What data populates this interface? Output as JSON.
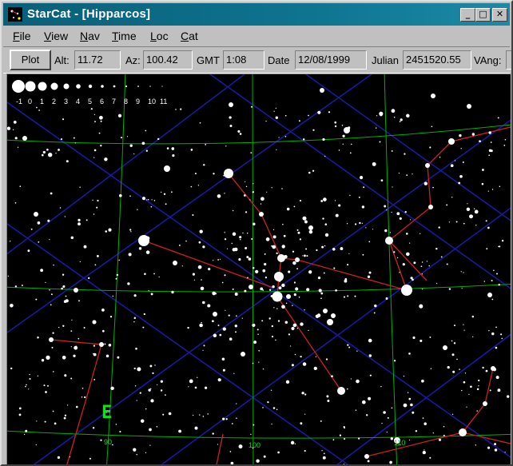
{
  "window": {
    "title": "StarCat - [Hipparcos]",
    "icon": "starcat-app-icon",
    "controls": {
      "minimize": "_",
      "maximize": "□",
      "close": "✕"
    }
  },
  "menu": [
    {
      "label": "File"
    },
    {
      "label": "View"
    },
    {
      "label": "Nav"
    },
    {
      "label": "Time"
    },
    {
      "label": "Loc"
    },
    {
      "label": "Cat"
    }
  ],
  "toolbar": {
    "plot_label": "Plot",
    "alt_label": "Alt:",
    "alt_value": "11.72",
    "az_label": "Az:",
    "az_value": "100.42",
    "gmt_label": "GMT",
    "gmt_value": "1:08",
    "date_label": "Date",
    "date_value": "12/08/1999",
    "julian_label": "Julian",
    "julian_value": "2451520.55",
    "vang_label": "VAng:"
  },
  "sky": {
    "magnitude_legend": [
      "-1",
      "0",
      "1",
      "2",
      "3",
      "4",
      "5",
      "6",
      "7",
      "8",
      "9",
      "10",
      "11"
    ],
    "horizon_marks": [
      "90",
      "100",
      "110"
    ],
    "direction_marker": "E",
    "colors": {
      "background": "#000000",
      "constellation_lines": "#cc2222",
      "coordinate_grid": "#00cc00",
      "equatorial_grid": "#1a1aa6",
      "stars": "#ffffff",
      "labels": "#00ee00"
    }
  }
}
